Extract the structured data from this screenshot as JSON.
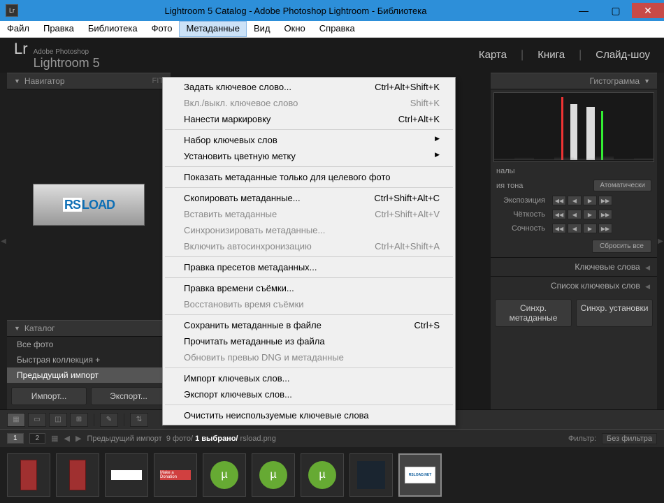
{
  "window": {
    "title": "Lightroom 5 Catalog - Adobe Photoshop Lightroom - Библиотека",
    "icon_label": "Lr"
  },
  "menubar": {
    "items": [
      "Файл",
      "Правка",
      "Библиотека",
      "Фото",
      "Метаданные",
      "Вид",
      "Окно",
      "Справка"
    ],
    "active_index": 4
  },
  "logo": {
    "lr": "Lr",
    "small": "Adobe Photoshop",
    "main": "Lightroom 5"
  },
  "module_tabs": [
    "Карта",
    "Книга",
    "Слайд-шоу"
  ],
  "left": {
    "navigator_label": "Навигатор",
    "navigator_modes": "FIT",
    "preview_rs": "RS",
    "preview_load": "LOAD",
    "catalog_label": "Каталог",
    "catalog_items": [
      "Все фото",
      "Быстрая коллекция +",
      "Предыдущий импорт"
    ],
    "catalog_selected_index": 2,
    "import_btn": "Импорт...",
    "export_btn": "Экспорт..."
  },
  "right": {
    "histogram_label": "Гистограмма",
    "originals_label": "налы",
    "tone_label": "ия тона",
    "auto_btn": "Атоматически",
    "rows": [
      {
        "label": "Экспозиция"
      },
      {
        "label": "Чёткость"
      },
      {
        "label": "Сочность"
      }
    ],
    "reset_btn": "Сбросить все",
    "keywords_label": "Ключевые слова",
    "keyword_list_label": "Список ключевых слов",
    "sync_meta_btn": "Синхр. метаданные",
    "sync_settings_btn": "Синхр. установки"
  },
  "filmstrip_bar": {
    "segments": [
      "1",
      "2"
    ],
    "active_seg": 0,
    "path_prefix": "Предыдущий импорт",
    "photo_count": "9 фото/",
    "selected": "1 выбрано/",
    "filename": "rsload.png",
    "filter_label": "Фильтр:",
    "filter_value": "Без фильтра"
  },
  "thumbnails": [
    {
      "kind": "red"
    },
    {
      "kind": "red"
    },
    {
      "kind": "white"
    },
    {
      "kind": "donate",
      "text": "Make a Donation"
    },
    {
      "kind": "utorrent"
    },
    {
      "kind": "utorrent"
    },
    {
      "kind": "utorrent"
    },
    {
      "kind": "dark"
    },
    {
      "kind": "rsload",
      "text": "RSLOAD.NET",
      "selected": true
    }
  ],
  "menu": {
    "items": [
      {
        "label": "Задать ключевое слово...",
        "shortcut": "Ctrl+Alt+Shift+K"
      },
      {
        "label": "Вкл./выкл. ключевое слово",
        "shortcut": "Shift+K",
        "disabled": true
      },
      {
        "label": "Нанести маркировку",
        "shortcut": "Ctrl+Alt+K"
      },
      {
        "sep": true
      },
      {
        "label": "Набор ключевых слов",
        "submenu": true
      },
      {
        "label": "Установить цветную метку",
        "submenu": true
      },
      {
        "sep": true
      },
      {
        "label": "Показать метаданные только для целевого фото"
      },
      {
        "sep": true
      },
      {
        "label": "Скопировать метаданные...",
        "shortcut": "Ctrl+Shift+Alt+C"
      },
      {
        "label": "Вставить метаданные",
        "shortcut": "Ctrl+Shift+Alt+V",
        "disabled": true
      },
      {
        "label": "Синхронизировать метаданные...",
        "disabled": true
      },
      {
        "label": "Включить автосинхронизацию",
        "shortcut": "Ctrl+Alt+Shift+A",
        "disabled": true
      },
      {
        "sep": true
      },
      {
        "label": "Правка пресетов метаданных..."
      },
      {
        "sep": true
      },
      {
        "label": "Правка времени съёмки..."
      },
      {
        "label": "Восстановить время съёмки",
        "disabled": true
      },
      {
        "sep": true
      },
      {
        "label": "Сохранить метаданные в файле",
        "shortcut": "Ctrl+S"
      },
      {
        "label": "Прочитать метаданные из файла"
      },
      {
        "label": "Обновить превью DNG и метаданные",
        "disabled": true
      },
      {
        "sep": true
      },
      {
        "label": "Импорт ключевых слов..."
      },
      {
        "label": "Экспорт ключевых слов..."
      },
      {
        "sep": true
      },
      {
        "label": "Очистить неиспользуемые ключевые слова"
      }
    ]
  }
}
